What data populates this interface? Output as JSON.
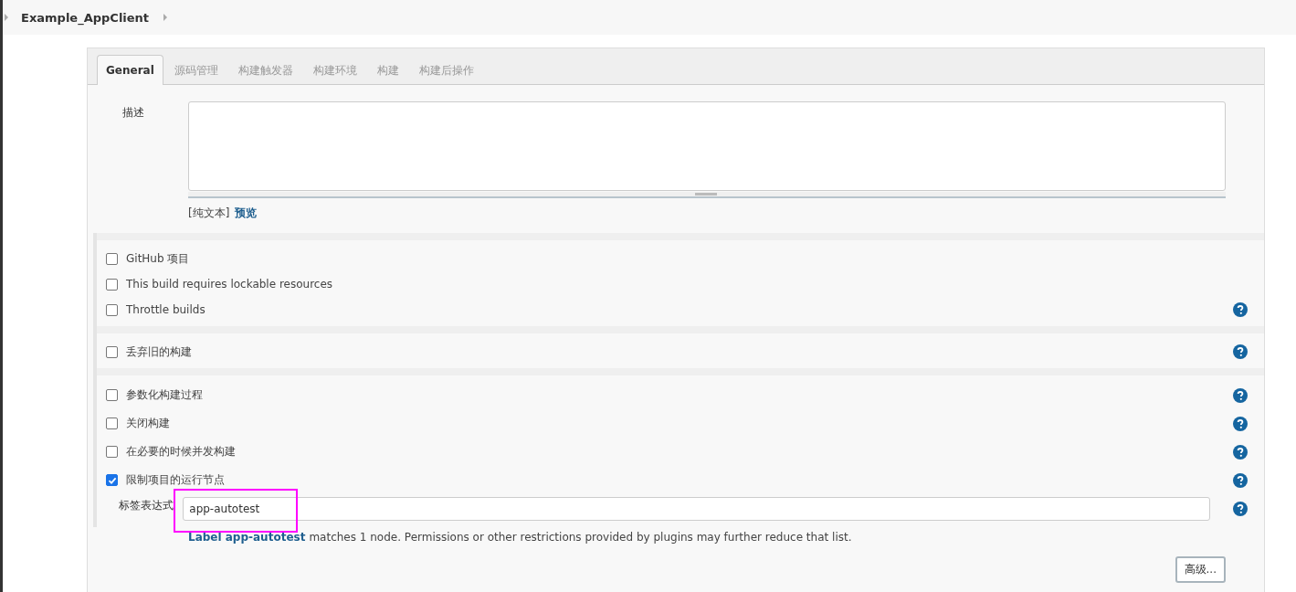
{
  "breadcrumb": {
    "title": "Example_AppClient"
  },
  "tabs": [
    {
      "label": "General",
      "selected": true
    },
    {
      "label": "源码管理",
      "selected": false
    },
    {
      "label": "构建触发器",
      "selected": false
    },
    {
      "label": "构建环境",
      "selected": false
    },
    {
      "label": "构建",
      "selected": false
    },
    {
      "label": "构建后操作",
      "selected": false
    }
  ],
  "description": {
    "label": "描述",
    "format": "[纯文本]",
    "preview_link": "预览"
  },
  "sections": [
    {
      "options": [
        {
          "label": "GitHub 项目",
          "checked": false,
          "help": false
        },
        {
          "label": "This build requires lockable resources",
          "checked": false,
          "help": false
        },
        {
          "label": "Throttle builds",
          "checked": false,
          "help": true
        }
      ]
    },
    {
      "options": [
        {
          "label": "丢弃旧的构建",
          "checked": false,
          "help": true
        }
      ]
    },
    {
      "options": [
        {
          "label": "参数化构建过程",
          "checked": false,
          "help": true
        },
        {
          "label": "关闭构建",
          "checked": false,
          "help": true
        },
        {
          "label": "在必要的时候并发构建",
          "checked": false,
          "help": true
        },
        {
          "label": "限制项目的运行节点",
          "checked": true,
          "help": true
        }
      ]
    }
  ],
  "label_expression": {
    "label": "标签表达式",
    "value": "app-autotest",
    "hint_link": "Label app-autotest",
    "hint_text": "matches 1 node. Permissions or other restrictions provided by plugins may further reduce that list."
  },
  "advanced_button": "高级..."
}
